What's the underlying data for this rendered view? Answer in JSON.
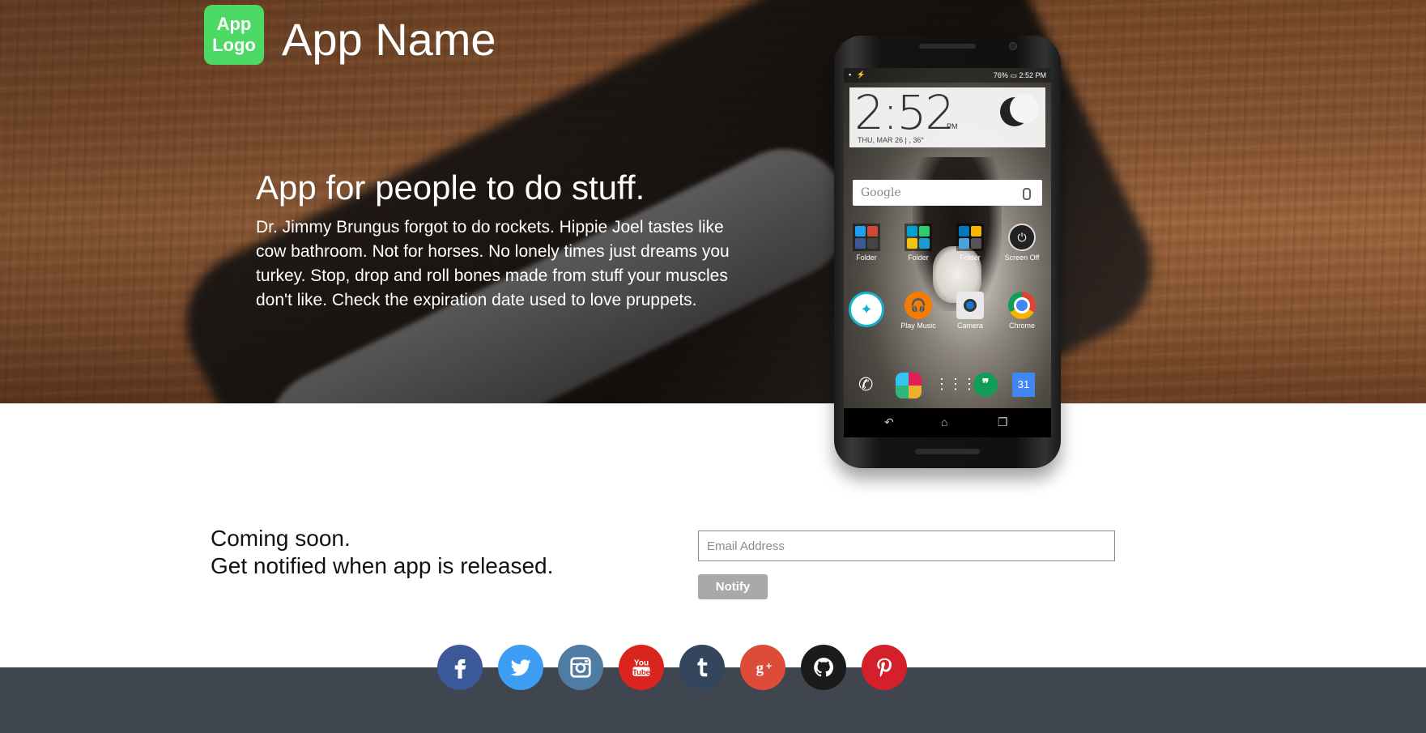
{
  "header": {
    "logo_line1": "App",
    "logo_line2": "Logo",
    "app_name": "App Name"
  },
  "hero": {
    "headline": "App for people to do stuff.",
    "description": "Dr. Jimmy Brungus forgot to do rockets. Hippie Joel tastes like cow bathroom. Not for horses. No lonely times just dreams you turkey. Stop, drop and roll bones made from stuff your muscles don't like. Check the expiration date used to love pruppets."
  },
  "phone_screen": {
    "status_time": "2:52 PM",
    "status_battery": "76%",
    "clock_time": "2:52",
    "clock_ampm": "PM",
    "clock_date": "THU, MAR 26 | , 36°",
    "search_brand": "Google",
    "row1": [
      {
        "label": "Folder"
      },
      {
        "label": "Folder"
      },
      {
        "label": "Folder"
      },
      {
        "label": "Screen Off"
      }
    ],
    "row2": [
      {
        "label": ""
      },
      {
        "label": "Play Music"
      },
      {
        "label": "Camera"
      },
      {
        "label": "Chrome"
      }
    ],
    "calendar_day": "31"
  },
  "signup": {
    "line1": "Coming soon.",
    "line2": "Get notified when app is released.",
    "email_placeholder": "Email Address",
    "notify_label": "Notify"
  },
  "social": {
    "icons": [
      "facebook-icon",
      "twitter-icon",
      "instagram-icon",
      "youtube-icon",
      "tumblr-icon",
      "google-plus-icon",
      "github-icon",
      "pinterest-icon"
    ],
    "colors": {
      "facebook": "#3b5998",
      "twitter": "#3d9df2",
      "instagram": "#4f7ca3",
      "youtube": "#d9251d",
      "tumblr": "#34465d",
      "google_plus": "#dd4b39",
      "github": "#1b1b1b",
      "pinterest": "#d3202a"
    }
  },
  "colors": {
    "logo_bg": "#4cd964",
    "footer_bg": "#3f4650",
    "button_bg": "#a9a9a9"
  }
}
